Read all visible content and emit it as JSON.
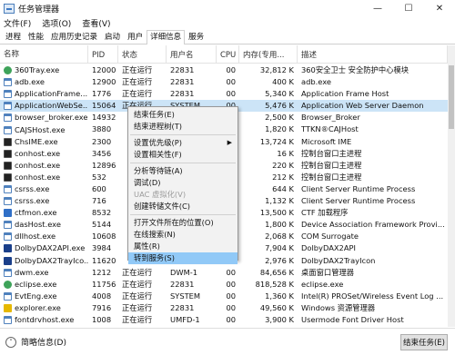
{
  "window": {
    "title": "任务管理器",
    "min": "—",
    "max": "☐",
    "close": "✕"
  },
  "menu": [
    "文件(F)",
    "选项(O)",
    "查看(V)"
  ],
  "tabs": [
    {
      "label": "进程",
      "active": false
    },
    {
      "label": "性能",
      "active": false
    },
    {
      "label": "应用历史记录",
      "active": false
    },
    {
      "label": "启动",
      "active": false
    },
    {
      "label": "用户",
      "active": false
    },
    {
      "label": "详细信息",
      "active": true
    },
    {
      "label": "服务",
      "active": false
    }
  ],
  "columns": {
    "name": "名称",
    "pid": "PID",
    "status": "状态",
    "user": "用户名",
    "cpu": "CPU",
    "mem": "内存(专用...",
    "desc": "描述"
  },
  "processes": [
    {
      "icon": "ic-grn",
      "icon_name": "360-shield-icon",
      "name": "360Tray.exe",
      "pid": "12000",
      "status": "正在运行",
      "user": "22831",
      "cpu": "00",
      "mem": "32,812 K",
      "desc": "360安全卫士 安全防护中心模块"
    },
    {
      "icon": "ic-app",
      "icon_name": "app-window-icon",
      "name": "adb.exe",
      "pid": "12900",
      "status": "正在运行",
      "user": "22831",
      "cpu": "00",
      "mem": "400 K",
      "desc": "adb.exe"
    },
    {
      "icon": "ic-app",
      "icon_name": "app-window-icon",
      "name": "ApplicationFrame...",
      "pid": "1776",
      "status": "正在运行",
      "user": "22831",
      "cpu": "00",
      "mem": "5,340 K",
      "desc": "Application Frame Host"
    },
    {
      "icon": "ic-app",
      "icon_name": "app-window-icon",
      "name": "ApplicationWebSe...",
      "pid": "15064",
      "status": "正在运行",
      "user": "SYSTEM",
      "cpu": "00",
      "mem": "5,476 K",
      "desc": "Application Web Server Daemon",
      "selected": true
    },
    {
      "icon": "ic-app",
      "icon_name": "app-window-icon",
      "name": "browser_broker.exe",
      "pid": "14932",
      "status": "",
      "user": "",
      "cpu": "00",
      "mem": "2,500 K",
      "desc": "Browser_Broker"
    },
    {
      "icon": "ic-app",
      "icon_name": "app-window-icon",
      "name": "CAJSHost.exe",
      "pid": "3880",
      "status": "",
      "user": "",
      "cpu": "00",
      "mem": "1,820 K",
      "desc": "TTKN®CAJHost"
    },
    {
      "icon": "ic-con",
      "icon_name": "console-icon",
      "name": "ChsIME.exe",
      "pid": "2300",
      "status": "",
      "user": "",
      "cpu": "00",
      "mem": "13,724 K",
      "desc": "Microsoft IME"
    },
    {
      "icon": "ic-con",
      "icon_name": "console-icon",
      "name": "conhost.exe",
      "pid": "3456",
      "status": "",
      "user": "",
      "cpu": "00",
      "mem": "16 K",
      "desc": "控制台窗口主进程"
    },
    {
      "icon": "ic-con",
      "icon_name": "console-icon",
      "name": "conhost.exe",
      "pid": "12896",
      "status": "",
      "user": "",
      "cpu": "00",
      "mem": "220 K",
      "desc": "控制台窗口主进程"
    },
    {
      "icon": "ic-con",
      "icon_name": "console-icon",
      "name": "conhost.exe",
      "pid": "532",
      "status": "",
      "user": "",
      "cpu": "00",
      "mem": "212 K",
      "desc": "控制台窗口主进程"
    },
    {
      "icon": "ic-app",
      "icon_name": "app-window-icon",
      "name": "csrss.exe",
      "pid": "600",
      "status": "",
      "user": "",
      "cpu": "00",
      "mem": "644 K",
      "desc": "Client Server Runtime Process"
    },
    {
      "icon": "ic-app",
      "icon_name": "app-window-icon",
      "name": "csrss.exe",
      "pid": "716",
      "status": "",
      "user": "",
      "cpu": "00",
      "mem": "1,132 K",
      "desc": "Client Server Runtime Process"
    },
    {
      "icon": "ic-blu",
      "icon_name": "ctf-icon",
      "name": "ctfmon.exe",
      "pid": "8532",
      "status": "",
      "user": "",
      "cpu": "00",
      "mem": "13,500 K",
      "desc": "CTF 加载程序"
    },
    {
      "icon": "ic-app",
      "icon_name": "app-window-icon",
      "name": "dasHost.exe",
      "pid": "5144",
      "status": "",
      "user": "",
      "cpu": "00",
      "mem": "1,800 K",
      "desc": "Device Association Framework Provi..."
    },
    {
      "icon": "ic-app",
      "icon_name": "app-window-icon",
      "name": "dllhost.exe",
      "pid": "10608",
      "status": "",
      "user": "",
      "cpu": "00",
      "mem": "2,068 K",
      "desc": "COM Surrogate"
    },
    {
      "icon": "ic-dbl",
      "icon_name": "dolby-icon",
      "name": "DolbyDAX2API.exe",
      "pid": "3984",
      "status": "",
      "user": "",
      "cpu": "00",
      "mem": "7,904 K",
      "desc": "DolbyDAX2API"
    },
    {
      "icon": "ic-dbl",
      "icon_name": "dolby-icon",
      "name": "DolbyDAX2TrayIco...",
      "pid": "11620",
      "status": "",
      "user": "",
      "cpu": "00",
      "mem": "2,976 K",
      "desc": "DolbyDAX2TrayIcon"
    },
    {
      "icon": "ic-app",
      "icon_name": "app-window-icon",
      "name": "dwm.exe",
      "pid": "1212",
      "status": "正在运行",
      "user": "DWM-1",
      "cpu": "00",
      "mem": "84,656 K",
      "desc": "桌面窗口管理器"
    },
    {
      "icon": "ic-grn",
      "icon_name": "eclipse-icon",
      "name": "eclipse.exe",
      "pid": "11756",
      "status": "正在运行",
      "user": "22831",
      "cpu": "00",
      "mem": "818,528 K",
      "desc": "eclipse.exe"
    },
    {
      "icon": "ic-app",
      "icon_name": "app-window-icon",
      "name": "EvtEng.exe",
      "pid": "4008",
      "status": "正在运行",
      "user": "SYSTEM",
      "cpu": "00",
      "mem": "1,360 K",
      "desc": "Intel(R) PROSet/Wireless Event Log ..."
    },
    {
      "icon": "ic-yel",
      "icon_name": "folder-icon",
      "name": "explorer.exe",
      "pid": "7916",
      "status": "正在运行",
      "user": "22831",
      "cpu": "00",
      "mem": "49,560 K",
      "desc": "Windows 资源管理器"
    },
    {
      "icon": "ic-app",
      "icon_name": "app-window-icon",
      "name": "fontdrvhost.exe",
      "pid": "1008",
      "status": "正在运行",
      "user": "UMFD-1",
      "cpu": "00",
      "mem": "3,900 K",
      "desc": "Usermode Font Driver Host"
    }
  ],
  "context_menu": [
    {
      "label": "结束任务(E)",
      "sep_after": false,
      "disabled": false,
      "arrow": false
    },
    {
      "label": "结束进程树(T)",
      "sep_after": true,
      "disabled": false,
      "arrow": false
    },
    {
      "label": "设置优先级(P)",
      "sep_after": false,
      "disabled": false,
      "arrow": true
    },
    {
      "label": "设置相关性(F)",
      "sep_after": true,
      "disabled": false,
      "arrow": false
    },
    {
      "label": "分析等待链(A)",
      "sep_after": false,
      "disabled": false,
      "arrow": false
    },
    {
      "label": "调试(D)",
      "sep_after": false,
      "disabled": false,
      "arrow": false
    },
    {
      "label": "UAC 虚拟化(V)",
      "sep_after": false,
      "disabled": true,
      "arrow": false
    },
    {
      "label": "创建转储文件(C)",
      "sep_after": true,
      "disabled": false,
      "arrow": false
    },
    {
      "label": "打开文件所在的位置(O)",
      "sep_after": false,
      "disabled": false,
      "arrow": false
    },
    {
      "label": "在线搜索(N)",
      "sep_after": false,
      "disabled": false,
      "arrow": false
    },
    {
      "label": "属性(R)",
      "sep_after": false,
      "disabled": false,
      "arrow": false
    },
    {
      "label": "转到服务(S)",
      "sep_after": false,
      "disabled": false,
      "arrow": false,
      "highlight": true
    }
  ],
  "footer": {
    "chevron": "˄",
    "label": "简略信息(D)",
    "end_task": "结束任务(E)"
  }
}
